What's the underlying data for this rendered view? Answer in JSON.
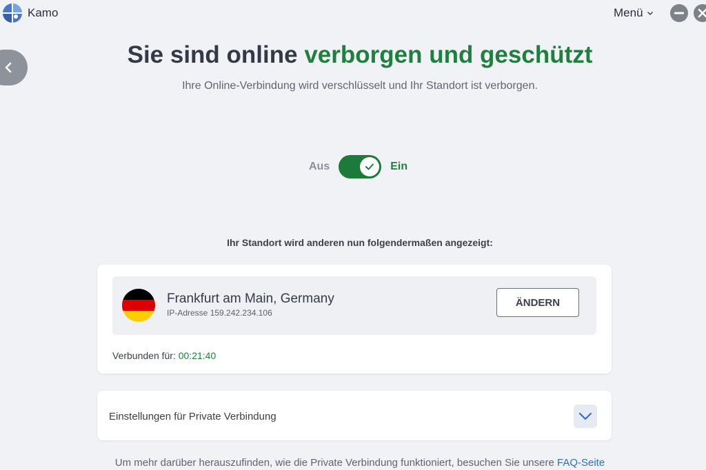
{
  "app": {
    "name": "Kamo"
  },
  "titlebar": {
    "menu_label": "Menü"
  },
  "headline": {
    "part1": "Sie sind online ",
    "part2": "verborgen und geschützt",
    "subtitle": "Ihre Online-Verbindung wird verschlüsselt und Ihr Standort ist verborgen."
  },
  "toggle": {
    "off_label": "Aus",
    "on_label": "Ein",
    "state": "on"
  },
  "location": {
    "intro": "Ihr Standort wird anderen nun folgendermaßen angezeigt:",
    "city": "Frankfurt am Main, Germany",
    "ip_label": "IP-Adresse 159.242.234.106",
    "change_label": "ÄNDERN",
    "connected_label": "Verbunden für: ",
    "connected_time": "00:21:40"
  },
  "settings": {
    "label": "Einstellungen für Private Verbindung"
  },
  "footer": {
    "text": "Um mehr darüber herauszufinden, wie die Private Verbindung funktioniert, besuchen Sie unsere ",
    "link": "FAQ-Seite"
  },
  "colors": {
    "accent_green": "#1f7f3e",
    "link_blue": "#2a6fc4",
    "background": "#f1f2f6",
    "flag": [
      "#000000",
      "#dd0000",
      "#ffce00"
    ]
  },
  "icons": {
    "logo": "kamo-logo-icon",
    "menu": "chevron-down-icon",
    "minimize": "minimize-icon",
    "close": "close-icon",
    "back": "chevron-left-icon",
    "toggle_check": "check-icon",
    "expand": "chevron-down-icon",
    "flag": "germany-flag-icon"
  }
}
